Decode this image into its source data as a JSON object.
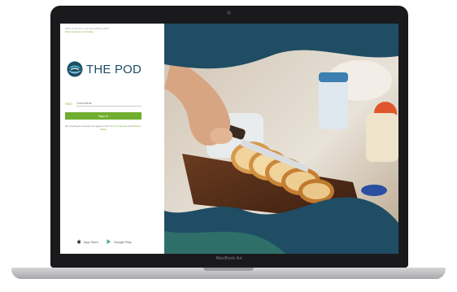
{
  "left_panel": {
    "top_note": {
      "text": "Want to comment, join and sharing jobs?",
      "link": "Find out about community"
    },
    "logo": {
      "text": "THE POD",
      "icon": "pod-logo-icon"
    },
    "username_field": {
      "tag": "SSO",
      "placeholder": "Username",
      "value": ""
    },
    "sign_in_button": "Sign in",
    "terms": {
      "prefix": "By creating an account you agree to the",
      "terms_link": "Terms of Service",
      "and": "and",
      "privacy_link": "Privacy Policy."
    },
    "stores": [
      {
        "label": "App Store",
        "icon": "apple-icon"
      },
      {
        "label": "Google Play",
        "icon": "google-play-icon"
      }
    ]
  },
  "hero": {
    "image": "bread-slicing-photo"
  },
  "device": {
    "model_label": "MacBook Air"
  },
  "colors": {
    "accent_green": "#6fae2e",
    "brand_teal": "#1e4e65",
    "dark_wave": "#1f4d63"
  }
}
